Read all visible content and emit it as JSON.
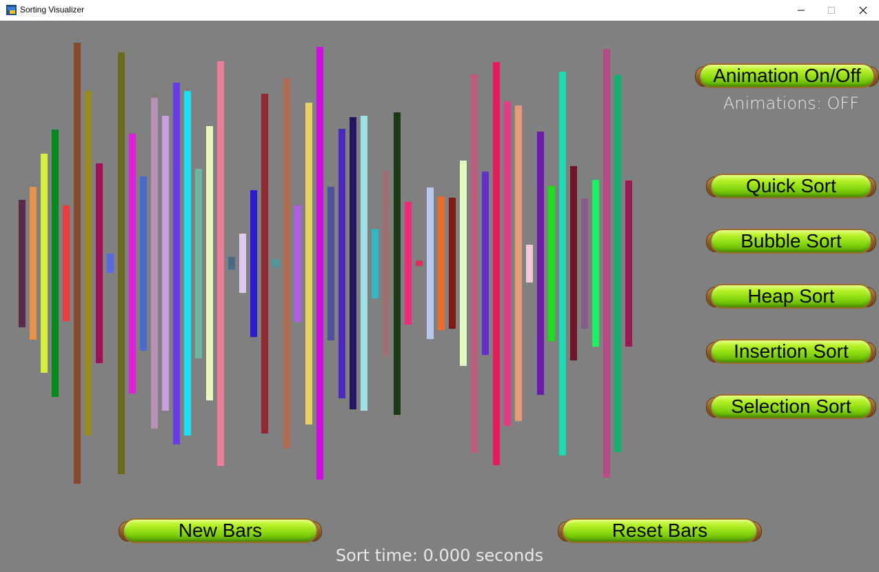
{
  "window": {
    "title": "Sorting Visualizer"
  },
  "status": {
    "animations": "Animations: OFF",
    "sort_time": "Sort time: 0.000 seconds"
  },
  "buttons": {
    "animation_toggle": "Animation On/Off",
    "quick_sort": "Quick Sort",
    "bubble_sort": "Bubble Sort",
    "heap_sort": "Heap Sort",
    "insertion_sort": "Insertion Sort",
    "selection_sort": "Selection Sort",
    "new_bars": "New Bars",
    "reset_bars": "Reset Bars"
  },
  "bars": [
    {
      "value": 185,
      "color": "#5b2a4e"
    },
    {
      "value": 222,
      "color": "#e8914a"
    },
    {
      "value": 318,
      "color": "#d6ef39"
    },
    {
      "value": 388,
      "color": "#008a1a"
    },
    {
      "value": 168,
      "color": "#f03a3a"
    },
    {
      "value": 640,
      "color": "#8a4a30"
    },
    {
      "value": 500,
      "color": "#9a8a1f"
    },
    {
      "value": 290,
      "color": "#a0105a"
    },
    {
      "value": 28,
      "color": "#5a6ae0"
    },
    {
      "value": 612,
      "color": "#6b6a1f"
    },
    {
      "value": 377,
      "color": "#e01ee0"
    },
    {
      "value": 253,
      "color": "#4a6ad0"
    },
    {
      "value": 480,
      "color": "#b890b8"
    },
    {
      "value": 428,
      "color": "#c8a0e0"
    },
    {
      "value": 525,
      "color": "#6a3ae8"
    },
    {
      "value": 500,
      "color": "#18e0f8"
    },
    {
      "value": 275,
      "color": "#6ab8a0"
    },
    {
      "value": 398,
      "color": "#e8f8c0"
    },
    {
      "value": 587,
      "color": "#f07a9a"
    },
    {
      "value": 18,
      "color": "#4a6a8a"
    },
    {
      "value": 86,
      "color": "#e0c8f0"
    },
    {
      "value": 213,
      "color": "#2a1ad0"
    },
    {
      "value": 493,
      "color": "#902a30"
    },
    {
      "value": 12,
      "color": "#4a9a9a"
    },
    {
      "value": 537,
      "color": "#b06a50"
    },
    {
      "value": 169,
      "color": "#b060e8"
    },
    {
      "value": 467,
      "color": "#e8d060"
    },
    {
      "value": 628,
      "color": "#d010e0"
    },
    {
      "value": 223,
      "color": "#5050a0"
    },
    {
      "value": 391,
      "color": "#4a28b8"
    },
    {
      "value": 424,
      "color": "#221660"
    },
    {
      "value": 428,
      "color": "#a0e0e8"
    },
    {
      "value": 101,
      "color": "#30b8c8"
    },
    {
      "value": 269,
      "color": "#a07070"
    },
    {
      "value": 439,
      "color": "#1a3a10"
    },
    {
      "value": 178,
      "color": "#f02a78"
    },
    {
      "value": 8,
      "color": "#e02a60"
    },
    {
      "value": 220,
      "color": "#b8c8f0"
    },
    {
      "value": 194,
      "color": "#f06a2a"
    },
    {
      "value": 190,
      "color": "#801a10"
    },
    {
      "value": 298,
      "color": "#e0f8c0"
    },
    {
      "value": 549,
      "color": "#c05a7a"
    },
    {
      "value": 266,
      "color": "#6030c8"
    },
    {
      "value": 585,
      "color": "#e81a5a"
    },
    {
      "value": 471,
      "color": "#e83a8a"
    },
    {
      "value": 458,
      "color": "#e89a78"
    },
    {
      "value": 55,
      "color": "#f0c8d8"
    },
    {
      "value": 382,
      "color": "#6a1aa8"
    },
    {
      "value": 225,
      "color": "#18e018"
    },
    {
      "value": 557,
      "color": "#1ad8b8"
    },
    {
      "value": 282,
      "color": "#701428"
    },
    {
      "value": 189,
      "color": "#8a5a8a"
    },
    {
      "value": 242,
      "color": "#18f060"
    },
    {
      "value": 622,
      "color": "#b84a8a"
    },
    {
      "value": 547,
      "color": "#10b070"
    },
    {
      "value": 241,
      "color": "#a01858"
    }
  ]
}
